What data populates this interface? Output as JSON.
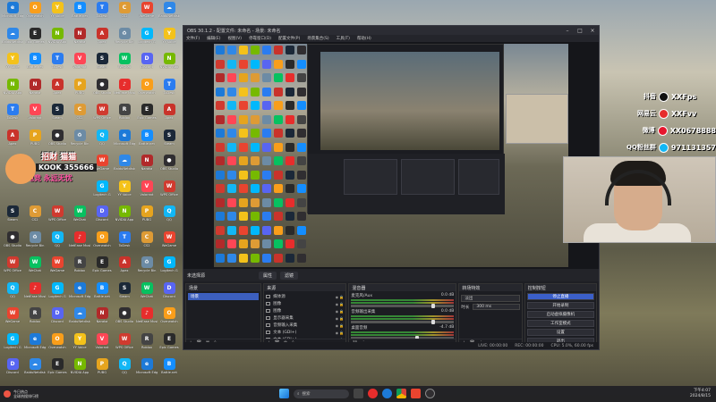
{
  "desktop": {
    "icons": [
      {
        "label": "Microsoft Edge",
        "glyph": "e",
        "color": "#1d7ad8"
      },
      {
        "label": "BaiduNetdisk",
        "glyph": "☁",
        "color": "#2f88e8"
      },
      {
        "label": "YY Voice",
        "glyph": "Y",
        "color": "#f4c21a"
      },
      {
        "label": "NVIDIA App",
        "glyph": "N",
        "color": "#76b900"
      },
      {
        "label": "ToDesk",
        "glyph": "T",
        "color": "#2b7cf0"
      },
      {
        "label": "Apex",
        "glyph": "A",
        "color": "#c9332b"
      },
      {
        "label": "Steam",
        "glyph": "S",
        "color": "#1b2838"
      },
      {
        "label": "OBS Studio",
        "glyph": "●",
        "color": "#302e31"
      },
      {
        "label": "WPS Office",
        "glyph": "W",
        "color": "#d03a2f"
      },
      {
        "label": "QQ",
        "glyph": "Q",
        "color": "#12b7f5"
      },
      {
        "label": "WeGame",
        "glyph": "W",
        "color": "#e9442f"
      },
      {
        "label": "Logitech G",
        "glyph": "G",
        "color": "#00b8fc"
      },
      {
        "label": "Discord",
        "glyph": "D",
        "color": "#5865f2"
      },
      {
        "label": "Overwatch",
        "glyph": "O",
        "color": "#f99e1a"
      },
      {
        "label": "Epic Games",
        "glyph": "E",
        "color": "#2a2a2a"
      },
      {
        "label": "Battle.net",
        "glyph": "B",
        "color": "#148eff"
      },
      {
        "label": "Naraka",
        "glyph": "N",
        "color": "#b12a2a"
      },
      {
        "label": "Valorant",
        "glyph": "V",
        "color": "#ff4655"
      },
      {
        "label": "PUBG",
        "glyph": "P",
        "color": "#e6a41e"
      },
      {
        "label": "CS2",
        "glyph": "C",
        "color": "#de9b35"
      },
      {
        "label": "Recycle Bin",
        "glyph": "♻",
        "color": "#6c8ba5"
      },
      {
        "label": "WeChat",
        "glyph": "W",
        "color": "#07c160"
      },
      {
        "label": "NetEase Music",
        "glyph": "♪",
        "color": "#e72d2c"
      },
      {
        "label": "Roblox",
        "glyph": "R",
        "color": "#444444"
      }
    ]
  },
  "overlay": {
    "logo_top": "招财 猫猫",
    "logo_kook": "KOOK 355666",
    "logo_bottom": "无忧电竞 永远无忧",
    "rows": [
      {
        "tag": "抖音",
        "value": "XXFps",
        "color": "#111111"
      },
      {
        "tag": "网易云",
        "value": "XXFvv",
        "color": "#e72d2c"
      },
      {
        "tag": "微博",
        "value": "XX0678888",
        "color": "#e6162d"
      },
      {
        "tag": "QQ粉丝群",
        "value": "971131357",
        "color": "#12b7f5"
      }
    ]
  },
  "obs": {
    "title": "OBS 30.1.2 - 配置文件: 未命名 - 场景: 未命名",
    "menu": [
      "文件(F)",
      "编辑(E)",
      "视图(V)",
      "停靠窗口(D)",
      "配置文件(P)",
      "场景集合(S)",
      "工具(T)",
      "帮助(H)"
    ],
    "scenebar": {
      "label": "未选择源",
      "props": "属性",
      "filters": "滤镜"
    },
    "scenes": {
      "title": "场景",
      "items": [
        "场景"
      ]
    },
    "sources": {
      "title": "来源",
      "items": [
        "媒体源",
        "图像",
        "图像",
        "显示器采集",
        "音频输入采集",
        "文本 (GDI+)",
        "文本 (GDI+)",
        "图像"
      ]
    },
    "mixer": {
      "title": "混音器",
      "rows": [
        {
          "name": "麦克风/Aux",
          "db": "0.0 dB"
        },
        {
          "name": "音频输出采集",
          "db": "0.0 dB"
        },
        {
          "name": "桌面音频",
          "db": "-4.7 dB"
        }
      ]
    },
    "transitions": {
      "title": "转场特效",
      "type": "淡出",
      "duration_label": "时长",
      "duration": "300 ms"
    },
    "controls": {
      "title": "控制按钮",
      "buttons": [
        "停止直播",
        "开始录制",
        "启动虚拟摄像机",
        "工作室模式",
        "设置",
        "退出"
      ]
    },
    "status": {
      "live": "LIVE: 00:00:00",
      "rec": "REC: 00:00:00",
      "cpu": "CPU: 5.0%, 60.00 fps"
    }
  },
  "taskbar": {
    "weather_temp": "今日热点",
    "weather_desc": "全球热搜排行榜",
    "search_placeholder": "搜索",
    "time": "下午4:07",
    "date": "2024/8/15"
  }
}
